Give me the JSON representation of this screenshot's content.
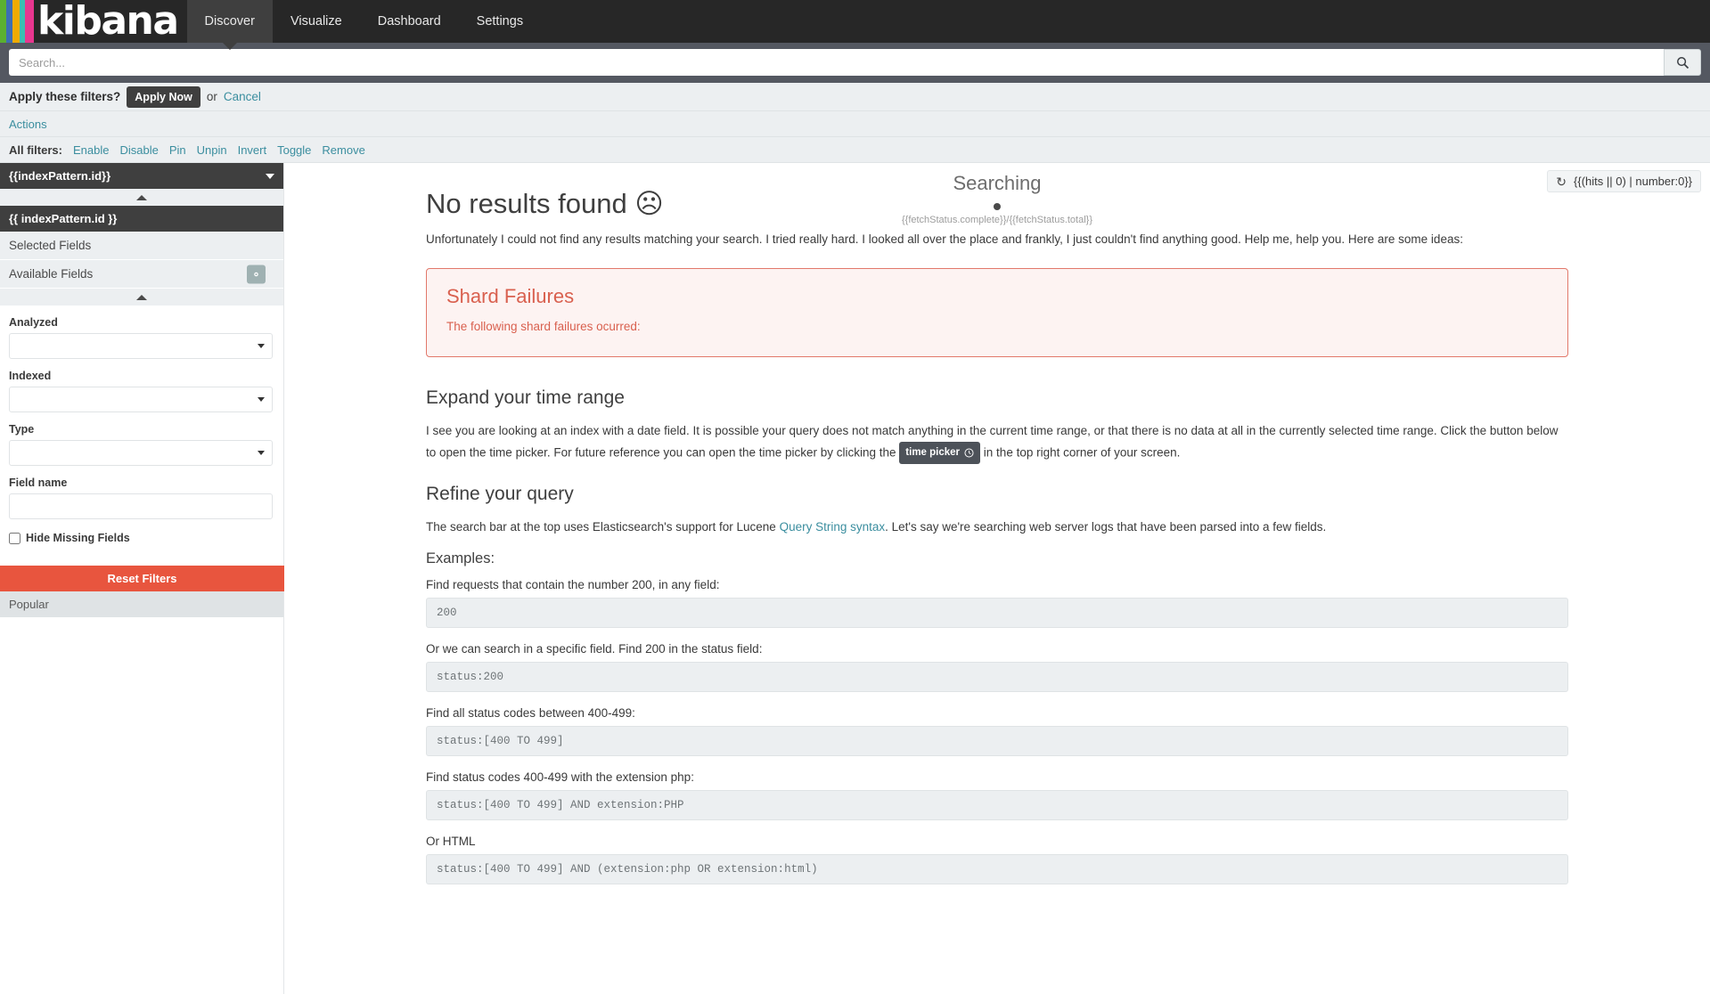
{
  "nav": {
    "brand": "kibana",
    "logo_bar_colors": [
      "#5bb030",
      "#3c6eb4",
      "#f0ab00",
      "#3cbeb1",
      "#e8368f"
    ],
    "items": [
      {
        "label": "Discover",
        "active": true
      },
      {
        "label": "Visualize",
        "active": false
      },
      {
        "label": "Dashboard",
        "active": false
      },
      {
        "label": "Settings",
        "active": false
      }
    ]
  },
  "search": {
    "placeholder": "Search...",
    "value": "",
    "button_icon": "search-icon"
  },
  "filter_apply": {
    "question": "Apply these filters?",
    "apply_label": "Apply Now",
    "or_text": "or",
    "cancel_label": "Cancel"
  },
  "filter_actions": {
    "actions_label": "Actions"
  },
  "all_filters": {
    "label": "All filters:",
    "actions": [
      "Enable",
      "Disable",
      "Pin",
      "Unpin",
      "Invert",
      "Toggle",
      "Remove"
    ]
  },
  "sidebar": {
    "index_pattern_header": "{{indexPattern.id}}",
    "index_pattern_section": "{{ indexPattern.id }}",
    "selected_fields": "Selected Fields",
    "available_fields": "Available Fields",
    "gear_icon": "gear-icon",
    "filters": [
      {
        "label": "Analyzed",
        "type": "select",
        "value": ""
      },
      {
        "label": "Indexed",
        "type": "select",
        "value": ""
      },
      {
        "label": "Type",
        "type": "select",
        "value": ""
      },
      {
        "label": "Field name",
        "type": "text",
        "value": ""
      }
    ],
    "hide_missing_label": "Hide Missing Fields",
    "hide_missing_checked": false,
    "reset_label": "Reset Filters",
    "reset_color": "#e8553e",
    "popular_label": "Popular"
  },
  "hits": {
    "refresh_icon": "refresh-icon",
    "value": "{{(hits || 0) | number:0}}"
  },
  "searching": {
    "title": "Searching",
    "status": "{{fetchStatus.complete}}/{{fetchStatus.total}}"
  },
  "main": {
    "no_results_title": "No results found ☹",
    "intro": "Unfortunately I could not find any results matching your search. I tried really hard. I looked all over the place and frankly, I just couldn't find anything good. Help me, help you. Here are some ideas:",
    "shard": {
      "title": "Shard Failures",
      "subtitle": "The following shard failures ocurred:",
      "border_color": "#e2786a",
      "bg_color": "#fdf3f2",
      "text_color": "#d9604f"
    },
    "time_range": {
      "title": "Expand your time range",
      "body_part1": "I see you are looking at an index with a date field. It is possible your query does not match anything in the current time range, or that there is no data at all in the currently selected time range. Click the button below to open the time picker. For future reference you can open the time picker by clicking the",
      "chip_label": "time picker",
      "chip_icon": "clock-icon",
      "body_part2": "in the top right corner of your screen."
    },
    "refine": {
      "title": "Refine your query",
      "body_part1": "The search bar at the top uses Elasticsearch's support for Lucene",
      "link_label": "Query String syntax",
      "body_part2": ". Let's say we're searching web server logs that have been parsed into a few fields.",
      "examples_heading": "Examples:",
      "examples": [
        {
          "label": "Find requests that contain the number 200, in any field:",
          "code": "200"
        },
        {
          "label": "Or we can search in a specific field. Find 200 in the status field:",
          "code": "status:200"
        },
        {
          "label": "Find all status codes between 400-499:",
          "code": "status:[400 TO 499]"
        },
        {
          "label": "Find status codes 400-499 with the extension php:",
          "code": "status:[400 TO 499] AND extension:PHP"
        },
        {
          "label": "Or HTML",
          "code": "status:[400 TO 499] AND (extension:php OR extension:html)"
        }
      ]
    }
  }
}
